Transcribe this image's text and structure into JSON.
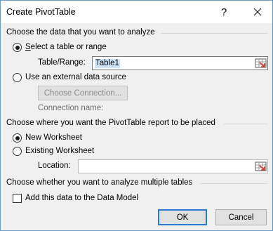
{
  "window": {
    "title": "Create PivotTable",
    "help_glyph": "?"
  },
  "source_section": {
    "heading": "Choose the data that you want to analyze",
    "option_table_label": "Select a table or range",
    "table_range_label": "Table/Range:",
    "table_range_value": "Table1",
    "option_external_label": "Use an external data source",
    "choose_connection_label": "Choose Connection...",
    "connection_name_label": "Connection name:"
  },
  "placement_section": {
    "heading": "Choose where you want the PivotTable report to be placed",
    "option_new_label": "New Worksheet",
    "option_existing_label": "Existing Worksheet",
    "location_label": "Location:",
    "location_value": ""
  },
  "multiple_section": {
    "heading": "Choose whether you want to analyze multiple tables",
    "data_model_label": "Add this data to the Data Model",
    "data_model_checked": false
  },
  "buttons": {
    "ok_label": "OK",
    "cancel_label": "Cancel"
  },
  "colors": {
    "accent": "#2b7ad0",
    "dialog_bg": "#f0f0f0",
    "selection": "#cde3f7"
  },
  "icons": {
    "range_picker": "range-selector-icon",
    "close": "close-icon"
  }
}
